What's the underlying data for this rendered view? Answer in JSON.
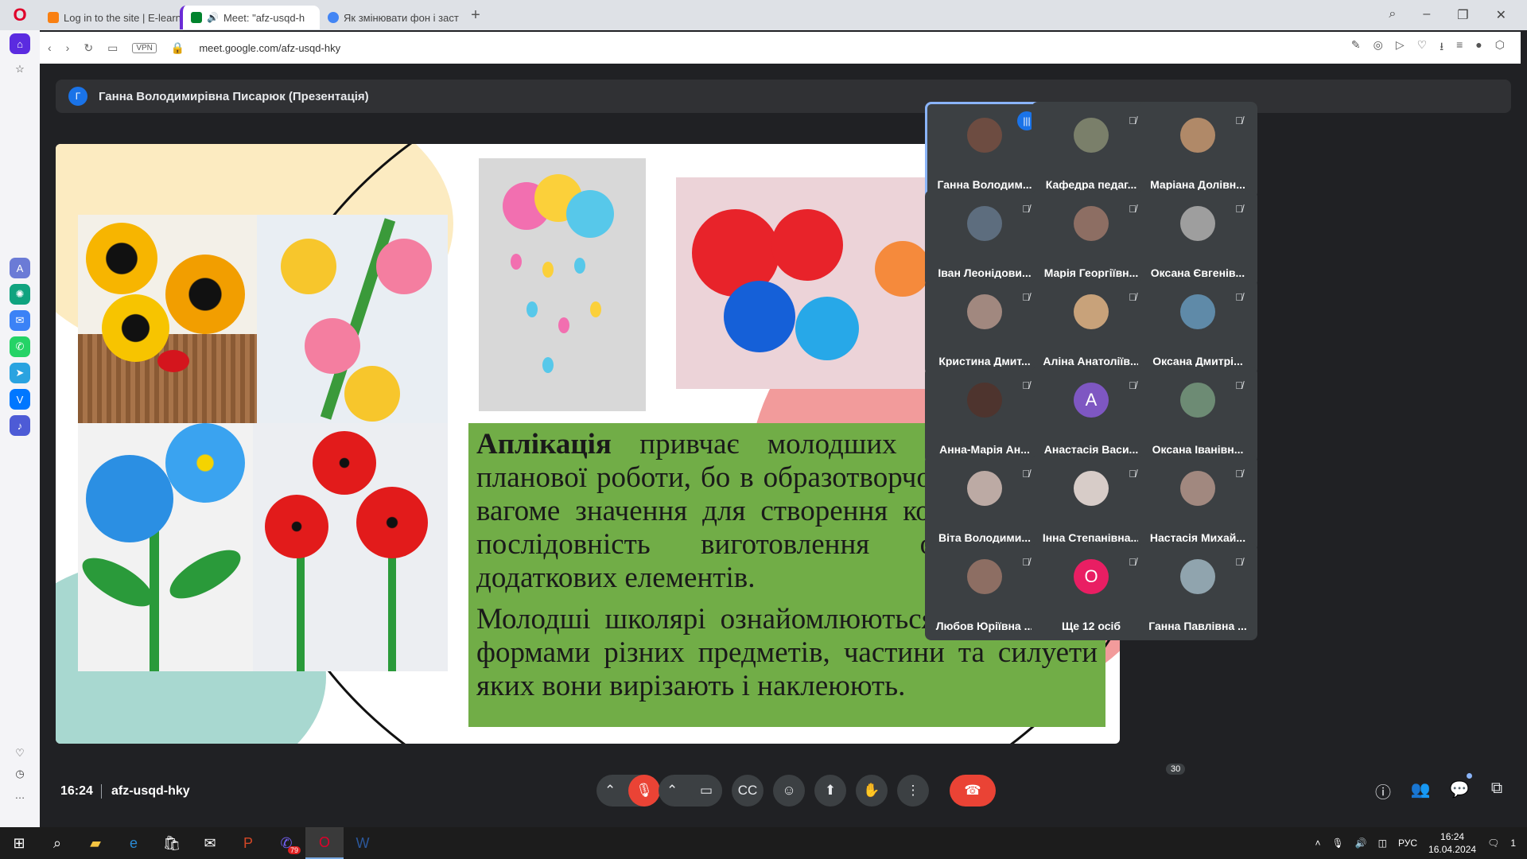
{
  "browser": {
    "tabs": [
      {
        "label": "Log in to the site | E-learni",
        "favicon_color": "#f98012"
      },
      {
        "label": "Meet: \"afz-usqd-h",
        "favicon_color": "#00832d",
        "active": true
      },
      {
        "label": "Як змінювати фон і заст",
        "favicon_color": "#4285f4"
      }
    ],
    "url": "meet.google.com/afz-usqd-hky",
    "vpn_label": "VPN"
  },
  "meet": {
    "presenter_initial": "Г",
    "presentation_title": "Ганна Володимирівна Писарюк (Презентація)",
    "slide": {
      "paragraph1_bold": "Аплікація",
      "paragraph1_rest": " привчає молодших школярів до планової роботи, бо в образотворчому мистецтві вагоме значення для створення композиції має послідовність виготовлення основних і додаткових елементів.",
      "paragraph2": "Молодші школярі ознайомлюються з простими формами різних предметів, частини та силуети яких вони вирізають і наклеюють."
    },
    "participants": [
      {
        "name": "Ганна Володим...",
        "speaking": true,
        "avatar_color": "#6d4c41"
      },
      {
        "name": "Кафедра педаг...",
        "avatar_color": "#7a7f6a"
      },
      {
        "name": "Маріана Долівн...",
        "avatar_color": "#b08968"
      },
      {
        "name": "Іван Леонідови...",
        "avatar_color": "#5d6d7e"
      },
      {
        "name": "Марія Георгіївн...",
        "avatar_color": "#8d6e63"
      },
      {
        "name": "Оксана Євгенів...",
        "avatar_color": "#9e9e9e"
      },
      {
        "name": "Кристина Дмит...",
        "avatar_color": "#a1887f"
      },
      {
        "name": "Аліна Анатоліїв...",
        "avatar_color": "#c8a27a"
      },
      {
        "name": "Оксана Дмитрі...",
        "avatar_color": "#5f8aa8"
      },
      {
        "name": "Анна-Марія Ан...",
        "avatar_color": "#4e342e"
      },
      {
        "name": "Анастасія Васи...",
        "avatar_letter": "А",
        "avatar_color": "#7e57c2"
      },
      {
        "name": "Оксана Іванівн...",
        "avatar_color": "#6d8b74"
      },
      {
        "name": "Віта Володими...",
        "avatar_color": "#bcaaa4"
      },
      {
        "name": "Інна Степанівна...",
        "avatar_color": "#d7ccc8"
      },
      {
        "name": "Настасія Михай...",
        "avatar_color": "#a1887f"
      },
      {
        "name": "Любов Юріївна ...",
        "avatar_color": "#8d6e63"
      },
      {
        "name": "Ще 12 осіб",
        "avatar_letter": "О",
        "avatar_color": "#e91e63"
      },
      {
        "name": "Ганна Павлівна ...",
        "avatar_color": "#90a4ae"
      }
    ],
    "time": "16:24",
    "meeting_code": "afz-usqd-hky",
    "people_count": "30"
  },
  "taskbar": {
    "lang": "РУС",
    "time": "16:24",
    "date": "16.04.2024",
    "viber_badge": "79",
    "notification_count": "1"
  }
}
